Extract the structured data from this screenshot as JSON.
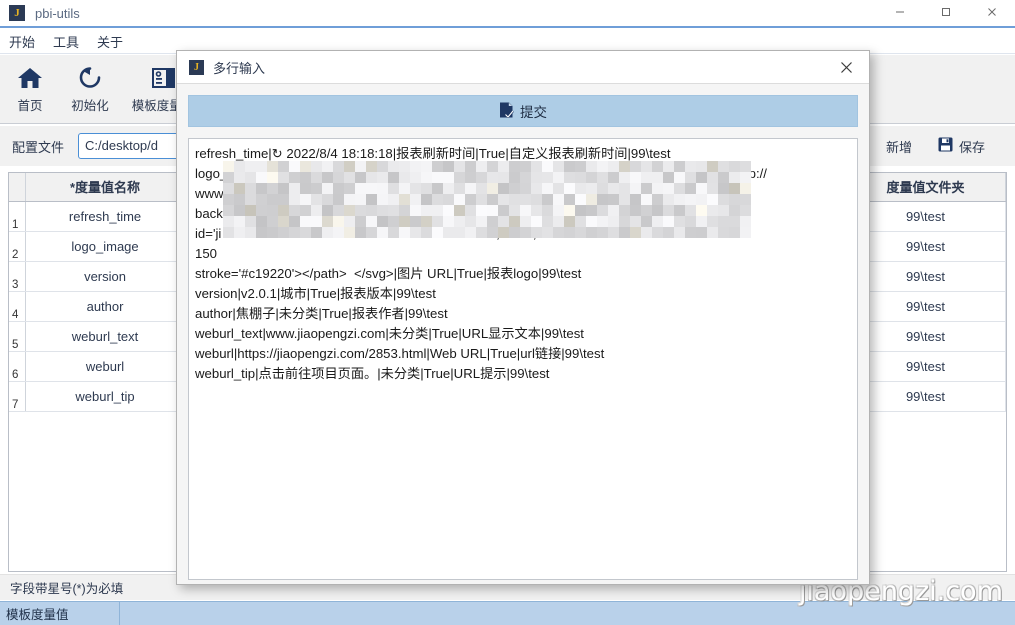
{
  "window": {
    "title": "pbi-utils",
    "logo_text": "J",
    "controls": {
      "minimize": "minimize-icon",
      "maximize": "maximize-icon",
      "close": "close-icon"
    }
  },
  "menubar": {
    "items": [
      {
        "label": "开始"
      },
      {
        "label": "工具"
      },
      {
        "label": "关于"
      }
    ]
  },
  "toolbar": {
    "items": [
      {
        "label": "首页",
        "icon": "home-icon"
      },
      {
        "label": "初始化",
        "icon": "refresh-icon"
      },
      {
        "label": "模板度量值",
        "icon": "template-icon"
      }
    ]
  },
  "config_row": {
    "label": "配置文件",
    "input_value": "C:/desktop/d",
    "add_button": "新增",
    "save_button": "保存"
  },
  "table": {
    "headers": [
      "",
      "*度量值名称",
      "",
      "度量值文件夹"
    ],
    "rows": [
      {
        "idx": "1",
        "name": "refresh_time",
        "folder": "99\\test"
      },
      {
        "idx": "2",
        "name": "logo_image",
        "folder": "99\\test"
      },
      {
        "idx": "3",
        "name": "version",
        "folder": "99\\test"
      },
      {
        "idx": "4",
        "name": "author",
        "folder": "99\\test"
      },
      {
        "idx": "5",
        "name": "weburl_text",
        "folder": "99\\test"
      },
      {
        "idx": "6",
        "name": "weburl",
        "folder": "99\\test"
      },
      {
        "idx": "7",
        "name": "weburl_tip",
        "folder": "99\\test"
      }
    ]
  },
  "footer": {
    "note": "字段带星号(*)为必填",
    "status_cell": "模板度量值"
  },
  "watermark": "jiaopengzi.com",
  "dialog": {
    "title": "多行输入",
    "logo_text": "J",
    "close_icon": "close-icon",
    "submit_label": "提交",
    "submit_icon": "submit-document-icon",
    "text_lines": [
      "refresh_time|↻ 2022/8/4 18:18:18|报表刷新时间|True|自定义报表刷新时间|99\\test",
      "logo_image|<svg id='jiaopengzi-logo-svg' viewBox='-230 -345 550 550' version='1.1' xmlns='http://",
      "www                                                                                  logo-svg-",
      "back                                                                                      <path",
      "id='ji                                                                      1 0,0 150,-30 L",
      "150                                                                                           ",
      "stroke='#c19220'></path>  </svg>|图片 URL|True|报表logo|99\\test",
      "version|v2.0.1|城市|True|报表版本|99\\test",
      "author|焦棚子|未分类|True|报表作者|99\\test",
      "weburl_text|www.jiaopengzi.com|未分类|True|URL显示文本|99\\test",
      "weburl|https://jiaopengzi.com/2853.html|Web URL|True|url链接|99\\test",
      "weburl_tip|点击前往项目页面。|未分类|True|URL提示|99\\test"
    ]
  },
  "colors": {
    "accent": "#2e3a50",
    "title_underline": "#6f9ed8",
    "submit_bg": "#aecde6",
    "status_bg": "#b9d1ea",
    "logo_gold": "#e8b422"
  }
}
